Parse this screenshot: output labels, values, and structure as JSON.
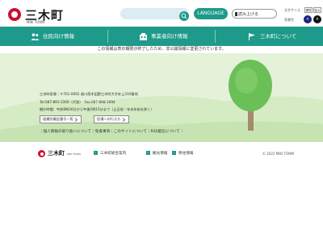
{
  "header": {
    "logo_name": "三木町",
    "logo_sub": "MIKI TOWN",
    "search_placeholder": "",
    "lang_label": "LANGUAGE",
    "readout_label": "読み上げる",
    "size_label": "文字サイズ",
    "size_small": "標準",
    "size_large": "拡大",
    "color_label": "背景色",
    "color_a": "A",
    "color_b": "A",
    "colors": {
      "brand": "#1e9a8a",
      "logo_red": "#c8102e"
    }
  },
  "nav": {
    "items": [
      {
        "label": "住民向け情報",
        "icon": "people-icon"
      },
      {
        "label": "事業者向け情報",
        "icon": "building-icon"
      },
      {
        "label": "三木町について",
        "icon": "flag-icon"
      }
    ]
  },
  "notice": "この情報は表示期限が終了したため、非公開情報に変更されています。",
  "footer": {
    "office": "三木町役場",
    "address": "〒761-0692 香川県木田郡三木町大字氷上310番地",
    "tel": "Tel:087-891-3300（代表）",
    "fax": "Fax:087-898-1994",
    "hours": "開庁時間：午前8時30分から午後5時15分まで（土日祝・年末年始を除く）",
    "btn_phone": "組織別電話番号一覧",
    "btn_access": "役場への行き方",
    "links": "｜個人情報の取り扱いについて｜免責事項｜このサイトについて｜RSS配信について｜"
  },
  "subfooter": {
    "logo_name": "三木町",
    "logo_sub": "MIKI TOWN",
    "links": [
      "三木町総合案内",
      "観光情報",
      "移住情報"
    ],
    "copyright": "© 2022 MIKI TOWN"
  }
}
